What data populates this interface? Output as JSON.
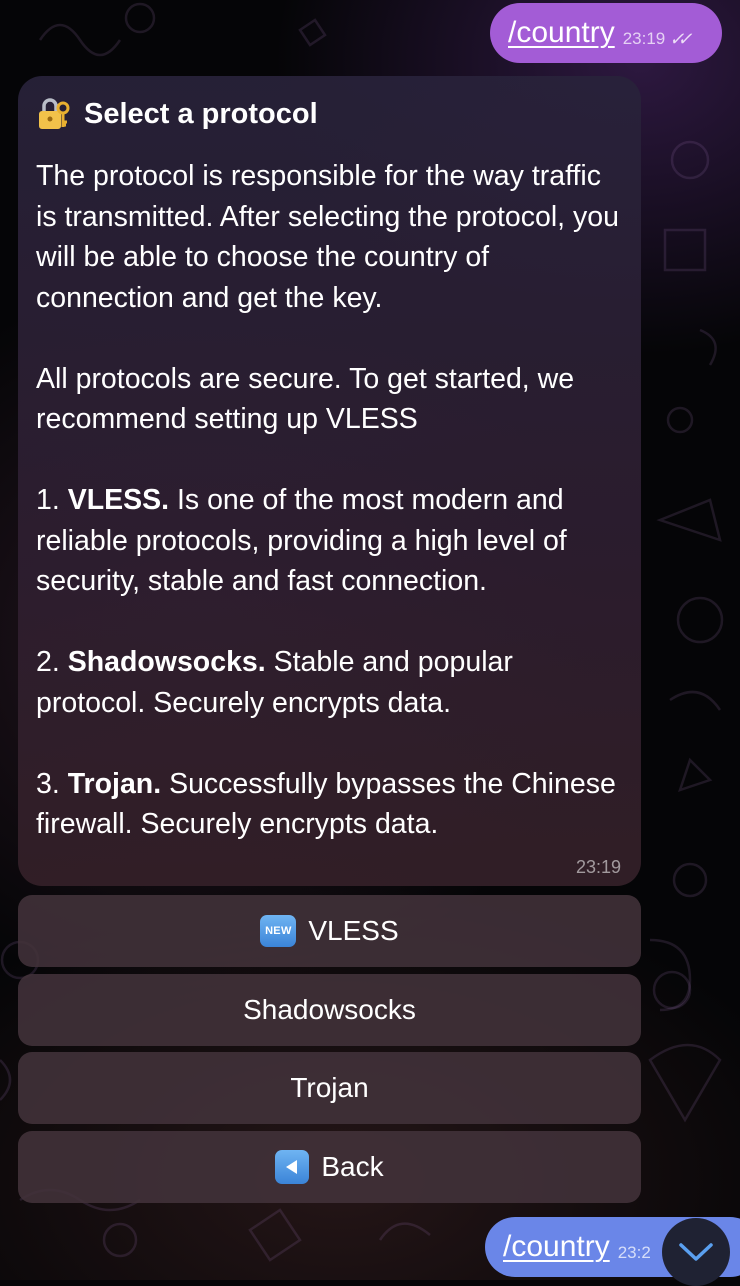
{
  "chat": {
    "outgoing_top": {
      "text": "/country",
      "time": "23:19"
    },
    "incoming": {
      "title": "Select a protocol",
      "intro": "The protocol is responsible for the way traffic is transmitted. After selecting the protocol, you will be able to choose the country of connection and get the key.",
      "recommend": "All protocols are secure. To get started, we recommend setting up VLESS",
      "items": [
        {
          "num": "1.",
          "name": "VLESS.",
          "desc": "Is one of the most modern and reliable protocols, providing a high level of security, stable and fast connection."
        },
        {
          "num": "2.",
          "name": "Shadowsocks.",
          "desc": "Stable and popular protocol. Securely encrypts data."
        },
        {
          "num": "3.",
          "name": "Trojan.",
          "desc": "Successfully bypasses the Chinese firewall. Securely encrypts data."
        }
      ],
      "time": "23:19",
      "title_icon": "lock-with-key-icon"
    },
    "keyboard": [
      {
        "label": "VLESS",
        "icon": "new-badge-icon",
        "icon_text": "NEW"
      },
      {
        "label": "Shadowsocks"
      },
      {
        "label": "Trojan"
      },
      {
        "label": "Back",
        "icon": "back-arrow-icon"
      }
    ],
    "outgoing_bottom": {
      "text": "/country",
      "time": "23:2"
    }
  },
  "colors": {
    "outgoing_bubble": "#a35cd6",
    "outgoing_bubble_bottom": "#6a86e8",
    "keyboard_button": "#42323a",
    "background": "#050507"
  }
}
